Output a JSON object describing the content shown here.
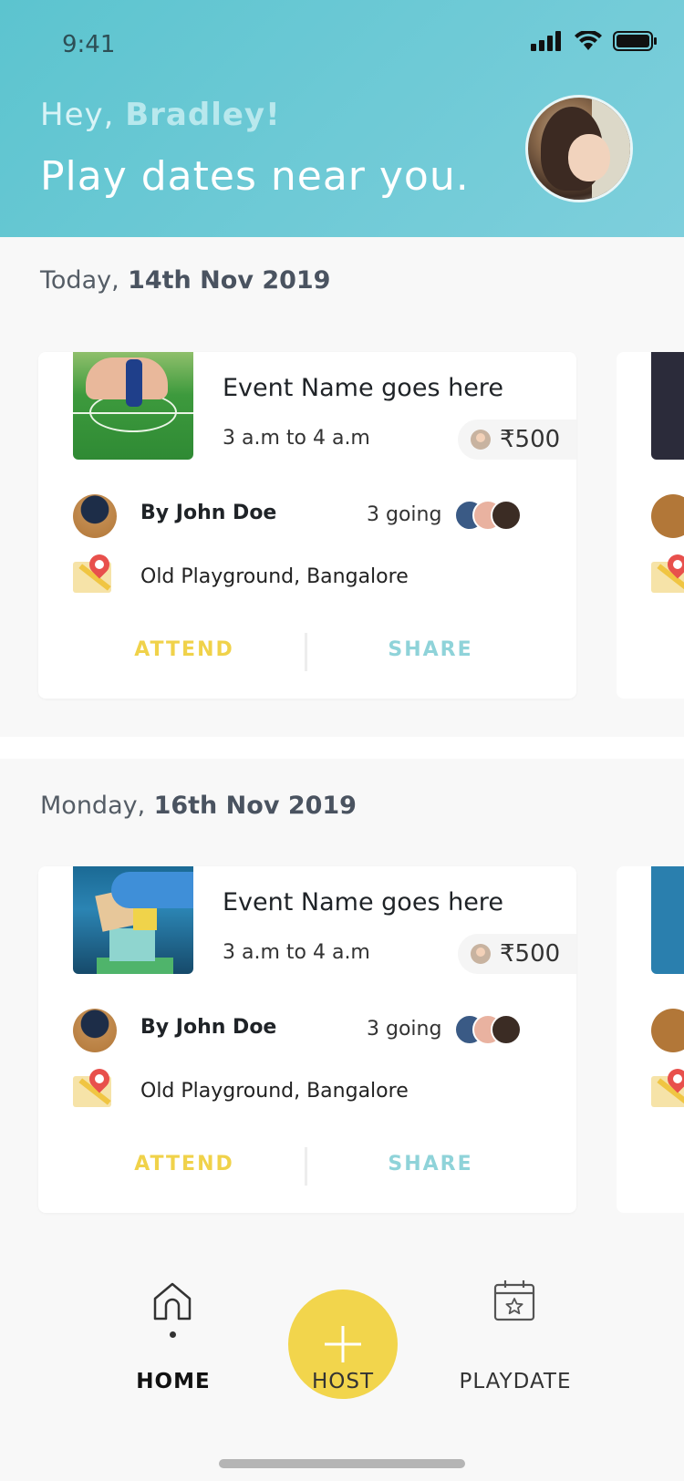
{
  "status_bar": {
    "time": "9:41"
  },
  "header": {
    "greeting_prefix": "Hey, ",
    "user_name": "Bradley!",
    "headline": "Play dates near you."
  },
  "sections": [
    {
      "date_prefix": "Today,",
      "date_bold": " 14th Nov 2019",
      "card": {
        "event_name": "Event Name goes here",
        "time": "3 a.m to 4 a.m",
        "price": "₹500",
        "host": "By John Doe",
        "going": "3 going",
        "location": "Old Playground, Bangalore",
        "attend": "ATTEND",
        "share": "SHARE"
      }
    },
    {
      "date_prefix": "Monday,",
      "date_bold": " 16th Nov 2019",
      "card": {
        "event_name": "Event Name goes here",
        "time": "3 a.m to 4 a.m",
        "price": "₹500",
        "host": "By John Doe",
        "going": "3 going",
        "location": "Old Playground, Bangalore",
        "attend": "ATTEND",
        "share": "SHARE"
      }
    }
  ],
  "nav": {
    "home": "HOME",
    "host": "HOST",
    "playdate": "PLAYDATE",
    "icons": [
      "home-icon",
      "plus-icon",
      "calendar-star-icon"
    ]
  },
  "colors": {
    "header_gradient_start": "#5cc4cf",
    "header_gradient_end": "#7ecfdc",
    "accent_yellow": "#f2d54c",
    "share_teal": "#8fd3d9"
  }
}
